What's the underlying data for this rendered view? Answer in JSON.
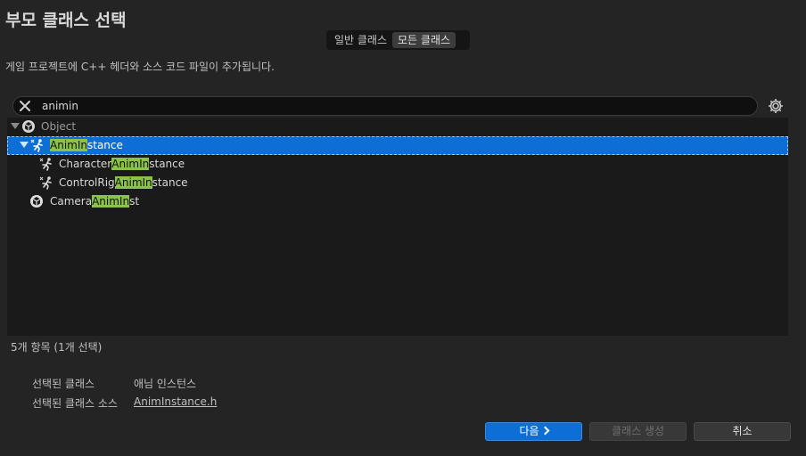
{
  "dialog": {
    "title": "부모 클래스 선택",
    "description": "게임 프로젝트에 C++ 헤더와 소스 코드 파일이 추가됩니다."
  },
  "mode_toggle": {
    "common": "일반 클래스",
    "all": "모든 클래스",
    "selected": "all"
  },
  "search": {
    "value": "animin",
    "placeholder": ""
  },
  "tree": {
    "root": "Object",
    "items": [
      {
        "pre": "",
        "match": "AnimIn",
        "post": "stance",
        "icon": "anim-icon",
        "selected": true,
        "expanded": true
      },
      {
        "pre": "Character",
        "match": "AnimIn",
        "post": "stance",
        "icon": "anim-icon",
        "selected": false
      },
      {
        "pre": "ControlRig",
        "match": "AnimIn",
        "post": "stance",
        "icon": "anim-icon",
        "selected": false
      },
      {
        "pre": "Camera",
        "match": "AnimIn",
        "post": "st",
        "icon": "class-icon",
        "selected": false
      }
    ]
  },
  "status": {
    "count": "5개 항목 (1개 선택)"
  },
  "info": {
    "selected_class_label": "선택된 클래스",
    "selected_class_value": "애님 인스턴스",
    "selected_source_label": "선택된 클래스 소스",
    "selected_source_value": "AnimInstance.h"
  },
  "buttons": {
    "next": "다음",
    "create": "클래스 생성",
    "cancel": "취소"
  },
  "colors": {
    "accent": "#0d6fd6",
    "highlight": "#8bc34a",
    "background": "#242424"
  }
}
